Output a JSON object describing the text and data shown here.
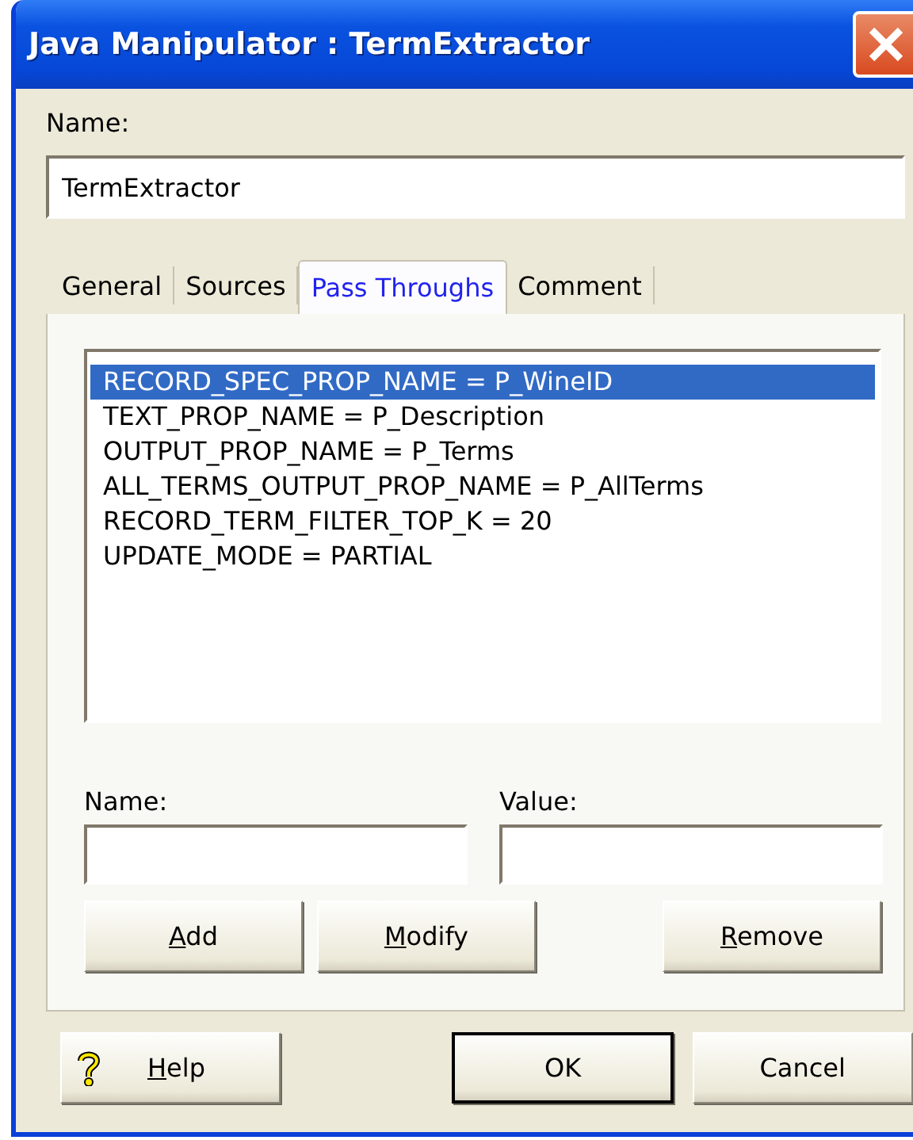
{
  "window": {
    "title": "Java Manipulator : TermExtractor"
  },
  "name_field": {
    "label": "Name:",
    "value": "TermExtractor"
  },
  "tabs": [
    {
      "label": "General",
      "selected": false
    },
    {
      "label": "Sources",
      "selected": false
    },
    {
      "label": "Pass Throughs",
      "selected": true
    },
    {
      "label": "Comment",
      "selected": false
    }
  ],
  "pass_throughs": [
    {
      "text": "RECORD_SPEC_PROP_NAME = P_WineID",
      "selected": true
    },
    {
      "text": "TEXT_PROP_NAME = P_Description",
      "selected": false
    },
    {
      "text": "OUTPUT_PROP_NAME = P_Terms",
      "selected": false
    },
    {
      "text": "ALL_TERMS_OUTPUT_PROP_NAME = P_AllTerms",
      "selected": false
    },
    {
      "text": "RECORD_TERM_FILTER_TOP_K = 20",
      "selected": false
    },
    {
      "text": "UPDATE_MODE = PARTIAL",
      "selected": false
    }
  ],
  "fields": [
    {
      "label": "Name:"
    },
    {
      "label": "Value:"
    }
  ],
  "panel_buttons": [
    {
      "label": "Add",
      "mnemonic": true
    },
    {
      "label": "Modify",
      "mnemonic": true
    },
    {
      "label": "Remove",
      "mnemonic": true
    }
  ],
  "footer_buttons": [
    {
      "label": "Help",
      "mnemonic": true,
      "kind": "help"
    },
    {
      "label": "OK",
      "mnemonic": false,
      "kind": "default"
    },
    {
      "label": "Cancel",
      "mnemonic": false,
      "kind": "plain"
    }
  ]
}
